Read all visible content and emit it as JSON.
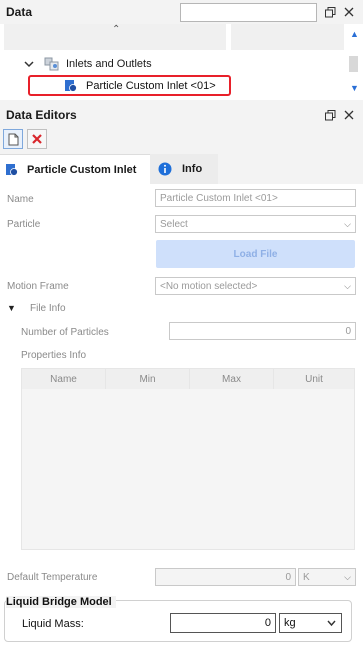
{
  "data_panel": {
    "title": "Data",
    "search_value": "",
    "tree": {
      "group_label": "Inlets and Outlets",
      "selected_item": "Particle Custom Inlet <01>"
    }
  },
  "editors_panel": {
    "title": "Data Editors",
    "tabs": [
      {
        "label": "Particle Custom Inlet"
      },
      {
        "label": "Info"
      }
    ]
  },
  "form": {
    "name_label": "Name",
    "name_value": "Particle Custom Inlet <01>",
    "particle_label": "Particle",
    "particle_value": "Select",
    "load_file_label": "Load File",
    "motion_frame_label": "Motion Frame",
    "motion_frame_value": "<No motion selected>",
    "file_info_label": "File Info",
    "num_particles_label": "Number of Particles",
    "num_particles_value": "0",
    "properties_info_label": "Properties Info",
    "table_headers": [
      "Name",
      "Min",
      "Max",
      "Unit"
    ],
    "default_temp_label": "Default Temperature",
    "default_temp_value": "0",
    "default_temp_unit": "K",
    "liquid_bridge_title": "Liquid Bridge Model",
    "liquid_mass_label": "Liquid Mass:",
    "liquid_mass_value": "0",
    "liquid_mass_unit": "kg"
  },
  "colors": {
    "selection_outline": "#e8202a",
    "load_button_bg": "#cfe0fb",
    "delete_icon": "#d9262c",
    "info_icon": "#1e6fd9"
  }
}
